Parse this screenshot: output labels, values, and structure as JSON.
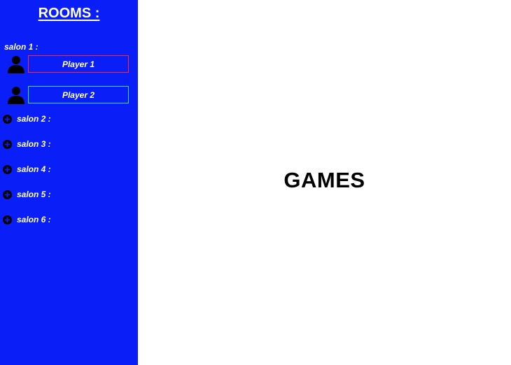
{
  "colors": {
    "sidebar_bg": "#0a1ef7",
    "main_bg": "#ffffff",
    "player1_border": "#ff2a2a",
    "player2_border": "#27e6c3"
  },
  "sidebar": {
    "title": "ROOMS :",
    "open_salon": {
      "label": "salon 1 :",
      "players": [
        {
          "name": "Player 1",
          "icon": "user-icon"
        },
        {
          "name": "Player 2",
          "icon": "user-icon"
        }
      ]
    },
    "salons": [
      {
        "label": "salon 2 :",
        "icon": "plus-circle-icon"
      },
      {
        "label": "salon 3 :",
        "icon": "plus-circle-icon"
      },
      {
        "label": "salon 4 :",
        "icon": "plus-circle-icon"
      },
      {
        "label": "salon 5 :",
        "icon": "plus-circle-icon"
      },
      {
        "label": "salon 6 :",
        "icon": "plus-circle-icon"
      }
    ]
  },
  "main": {
    "title": "GAMES"
  }
}
